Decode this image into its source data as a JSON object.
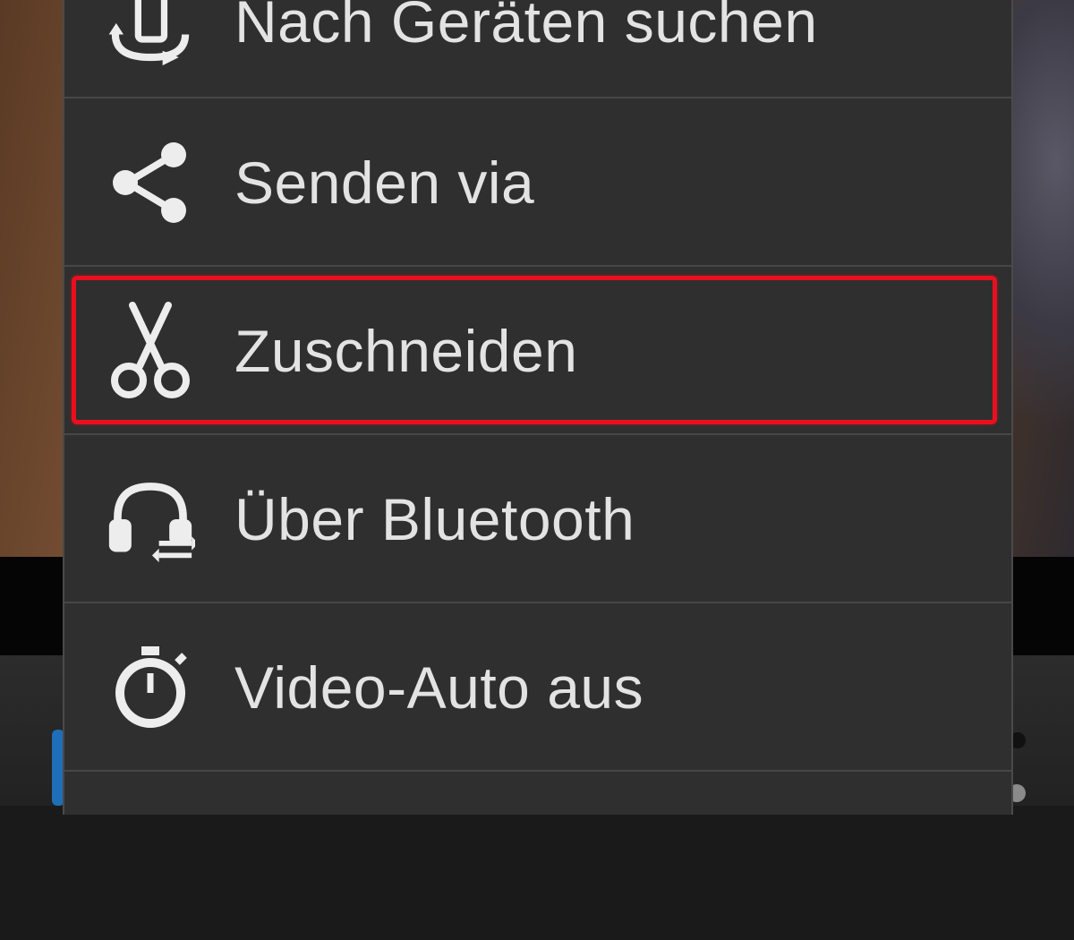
{
  "menu": {
    "items": [
      {
        "label": "Nach Geräten suchen",
        "icon": "device-scan-icon"
      },
      {
        "label": "Senden via",
        "icon": "share-icon"
      },
      {
        "label": "Zuschneiden",
        "icon": "scissors-icon",
        "highlighted": true
      },
      {
        "label": "Über Bluetooth",
        "icon": "bluetooth-headset-icon"
      },
      {
        "label": "Video-Auto aus",
        "icon": "stopwatch-icon"
      }
    ],
    "highlight_color": "#e8101f"
  }
}
